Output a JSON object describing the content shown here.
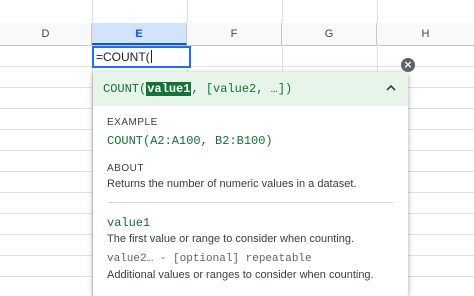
{
  "columns": [
    {
      "label": "D",
      "active": false
    },
    {
      "label": "E",
      "active": true
    },
    {
      "label": "F",
      "active": false
    },
    {
      "label": "G",
      "active": false
    },
    {
      "label": "H",
      "active": false
    }
  ],
  "cell": {
    "value": "=COUNT("
  },
  "help": {
    "signature_prefix": "COUNT(",
    "signature_param": "value1",
    "signature_rest": ", [value2, …])",
    "example_heading": "EXAMPLE",
    "example_code": "COUNT(A2:A100, B2:B100)",
    "about_heading": "ABOUT",
    "about_text": "Returns the number of numeric values in a dataset.",
    "param1_name": "value1",
    "param1_desc": "The first value or range to consider when counting.",
    "param2_name": "value2… - [optional] repeatable",
    "param2_desc": "Additional values or ranges to consider when counting."
  },
  "icons": {
    "close": "close-icon",
    "collapse": "chevron-up-icon"
  },
  "colors": {
    "accent": "#1a73e8",
    "help_header_bg": "#e6f4ea",
    "help_green": "#137333"
  }
}
